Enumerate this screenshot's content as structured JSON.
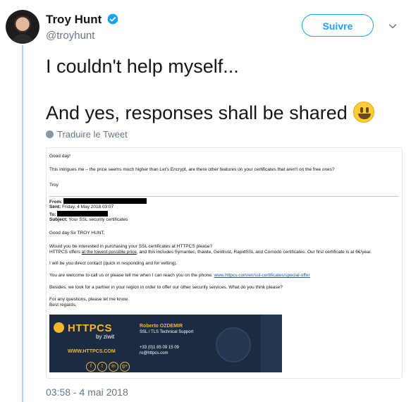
{
  "user": {
    "name": "Troy Hunt",
    "handle": "@troyhunt"
  },
  "follow_label": "Suivre",
  "tweet": {
    "line1": "I couldn't help myself...",
    "line2": "And yes, responses shall be shared"
  },
  "translate_label": "Traduire le Tweet",
  "email": {
    "greeting": "Good day!",
    "question": "This intrigues me – the price seems much higher than Let's Encrypt, are there other features on your certificates that aren't on the free ones?",
    "signoff": "Troy",
    "from_label": "From:",
    "sent_label": "Sent:",
    "sent_value": "Friday, 4 May 2018 03:07",
    "to_label": "To:",
    "subject_label": "Subject:",
    "subject_value": "Your SSL security certificates",
    "salutation": "Good day Sir TROY HUNT,",
    "para1_line1": "Would you be interested in purchasing your SSL certificates at HTTPCS please?",
    "para1_line2_a": "HTTPCS offers ",
    "para1_line2_link": "at the lowest possible price",
    "para1_line2_b": ", and this includes Symantec, thawte, Geotrust, RapidSSL and Comodo certificates. Our first certificate is at 6€/year.",
    "para2": "I will be you direct contact (quick in responding and for vetting).",
    "para3_a": "You are welcome to call us or please tell me when I can reach you on the phone: ",
    "para3_link": "www.httpcs.com/en/ssl-certificates/special-offer",
    "para4": "Besides, we look for a partner in your region in order to offer our other security services. What do you think please?",
    "para5_line1": "For any questions, please let me know.",
    "para5_line2": "Best regards,"
  },
  "signature": {
    "brand_a": "HTTP",
    "brand_b": "CS",
    "by": "by ziwit",
    "url": "WWW.HTTPCS.COM",
    "person": "Roberto OZDEMIR",
    "role": "SSL / TLS Technical Support",
    "phone": "+33 (0)1 85 09 15 09",
    "email": "ro@httpcs.com",
    "social": [
      "f",
      "t",
      "in",
      "g+"
    ]
  },
  "timestamp": "03:58 - 4 mai 2018",
  "colors": {
    "accent": "#1da1f2",
    "muted": "#657786",
    "thread": "#a8d6f5"
  }
}
